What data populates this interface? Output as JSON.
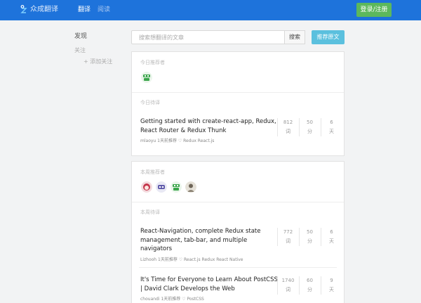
{
  "header": {
    "logo_text": "众成翻译",
    "nav": [
      "翻译",
      "阅读"
    ],
    "login_label": "登录/注册",
    "colors": {
      "bar": "#1e73db",
      "login": "#5cb85c"
    }
  },
  "sidebar": {
    "discover": "发现",
    "follow": "关注",
    "add_follow": "+ 添加关注"
  },
  "search": {
    "placeholder": "搜索想翻译的文章",
    "button": "搜索",
    "recommend_button": "推荐原文"
  },
  "today": {
    "recommenders_label": "今日推荐者",
    "translations_label": "今日待译",
    "articles": [
      {
        "title": "Getting started with create-react-app, Redux, React Router & Redux Thunk",
        "meta": "mlaoyu 1天前推荐 ♡ Redux React.js",
        "words": "812",
        "words_unit": "词",
        "score": "50",
        "score_unit": "分",
        "days": "6",
        "days_unit": "天"
      }
    ]
  },
  "week": {
    "recommenders_label": "本周推荐者",
    "translations_label": "本周待译",
    "articles": [
      {
        "title": "React-Navigation, complete Redux state management, tab-bar, and multiple navigators",
        "meta": "Lizhooh 1天前推荐 ♡ React.js Redux React Native",
        "words": "772",
        "words_unit": "词",
        "score": "50",
        "score_unit": "分",
        "days": "6",
        "days_unit": "天"
      },
      {
        "title": "It's Time for Everyone to Learn About PostCSS | David Clark Develops the Web",
        "meta": "chouandi 1天前推荐 ♡ PostCSS",
        "words": "1740",
        "words_unit": "词",
        "score": "60",
        "score_unit": "分",
        "days": "9",
        "days_unit": "天"
      }
    ]
  }
}
